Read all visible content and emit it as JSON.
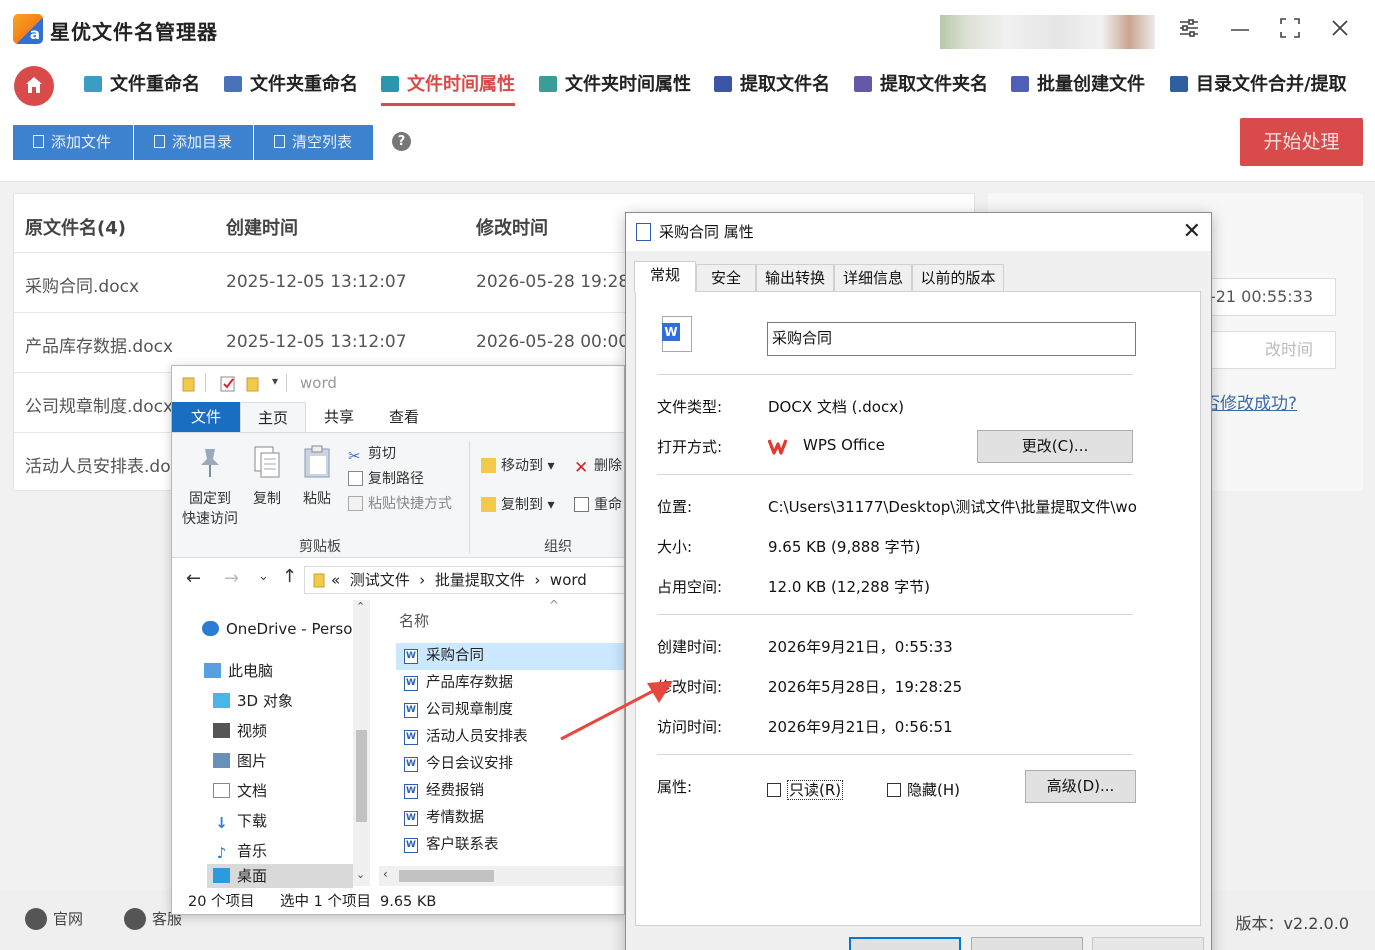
{
  "app": {
    "title": "星优文件名管理器",
    "logo_letter": "a",
    "window_controls": {
      "settings": "⚙",
      "minimize": "—",
      "maximize": "⛶",
      "close": "✕"
    }
  },
  "nav": {
    "items": [
      {
        "label": "文件重命名",
        "active": false,
        "icon_color": "#3a9dc4"
      },
      {
        "label": "文件夹重命名",
        "active": false,
        "icon_color": "#4a72b8"
      },
      {
        "label": "文件时间属性",
        "active": true,
        "icon_color": "#2a96b0"
      },
      {
        "label": "文件夹时间属性",
        "active": false,
        "icon_color": "#3a9d9a"
      },
      {
        "label": "提取文件名",
        "active": false,
        "icon_color": "#3d55a6"
      },
      {
        "label": "提取文件夹名",
        "active": false,
        "icon_color": "#6658a8"
      },
      {
        "label": "批量创建文件",
        "active": false,
        "icon_color": "#4f5fb5"
      },
      {
        "label": "目录文件合并/提取",
        "active": false,
        "icon_color": "#2f5f9e"
      }
    ]
  },
  "toolbar": {
    "add_file": "添加文件",
    "add_dir": "添加目录",
    "clear_list": "清空列表",
    "help": "?",
    "start": "开始处理"
  },
  "table": {
    "headers": [
      "原文件名(4)",
      "创建时间",
      "修改时间"
    ],
    "rows": [
      [
        "采购合同.docx",
        "2025-12-05 13:12:07",
        "2026-05-28 19:28:2"
      ],
      [
        "产品库存数据.docx",
        "2025-12-05 13:12:07",
        "2026-05-28 00:00:0"
      ],
      [
        "公司规章制度.docx",
        "",
        ""
      ],
      [
        "活动人员安排表.do",
        "",
        ""
      ]
    ]
  },
  "right_panel": {
    "field1": "9-21 00:55:33",
    "field2": "改时间",
    "link": "否修改成功?"
  },
  "footer": {
    "site": "官网",
    "support": "客服",
    "version": "版本：v2.2.0.0"
  },
  "explorer": {
    "title": "word",
    "tabs": [
      "文件",
      "主页",
      "共享",
      "查看"
    ],
    "ribbon": {
      "pin": [
        "固定到",
        "快速访问"
      ],
      "copy": "复制",
      "paste": "粘贴",
      "cut": "剪切",
      "copy_path": "复制路径",
      "paste_shortcut": "粘贴快捷方式",
      "move_to": "移动到",
      "copy_to": "复制到",
      "delete": "删除",
      "rename": "重命",
      "group_clipboard": "剪贴板",
      "group_organize": "组织"
    },
    "address": {
      "prefix": "«",
      "crumbs": [
        "测试文件",
        "批量提取文件",
        "word"
      ]
    },
    "nav_pane": [
      {
        "label": "OneDrive - Persor",
        "icon": "cloud-icon"
      },
      {
        "label": "此电脑",
        "icon": "pc-icon"
      },
      {
        "label": "3D 对象",
        "icon": "cube-icon"
      },
      {
        "label": "视频",
        "icon": "video-icon"
      },
      {
        "label": "图片",
        "icon": "picture-icon"
      },
      {
        "label": "文档",
        "icon": "document-icon"
      },
      {
        "label": "下载",
        "icon": "download-icon"
      },
      {
        "label": "音乐",
        "icon": "music-icon"
      },
      {
        "label": "桌面",
        "icon": "desktop-icon"
      }
    ],
    "column_name": "名称",
    "files": [
      "采购合同",
      "产品库存数据",
      "公司规章制度",
      "活动人员安排表",
      "今日会议安排",
      "经费报销",
      "考情数据",
      "客户联系表"
    ],
    "status": {
      "count": "20 个项目",
      "selected": "选中 1 个项目",
      "size": "9.65 KB"
    }
  },
  "props": {
    "title": "采购合同 属性",
    "tabs": [
      "常规",
      "安全",
      "输出转换",
      "详细信息",
      "以前的版本"
    ],
    "file_name": "采购合同",
    "file_type_label": "文件类型:",
    "file_type": "DOCX 文档 (.docx)",
    "open_with_label": "打开方式:",
    "open_with": "WPS Office",
    "change_btn": "更改(C)...",
    "location_label": "位置:",
    "location": "C:\\Users\\31177\\Desktop\\测试文件\\批量提取文件\\wo",
    "size_label": "大小:",
    "size": "9.65 KB (9,888 字节)",
    "disk_label": "占用空间:",
    "disk": "12.0 KB (12,288 字节)",
    "created_label": "创建时间:",
    "created": "2026年9月21日，0:55:33",
    "modified_label": "修改时间:",
    "modified": "2026年5月28日，19:28:25",
    "accessed_label": "访问时间:",
    "accessed": "2026年9月21日，0:56:51",
    "attr_label": "属性:",
    "readonly": "只读(R)",
    "hidden": "隐藏(H)",
    "advanced_btn": "高级(D)..."
  },
  "colors": {
    "accent_red": "#d94b4b",
    "toolbar_blue": "#3d82cf",
    "arrow": "#e8463f"
  }
}
